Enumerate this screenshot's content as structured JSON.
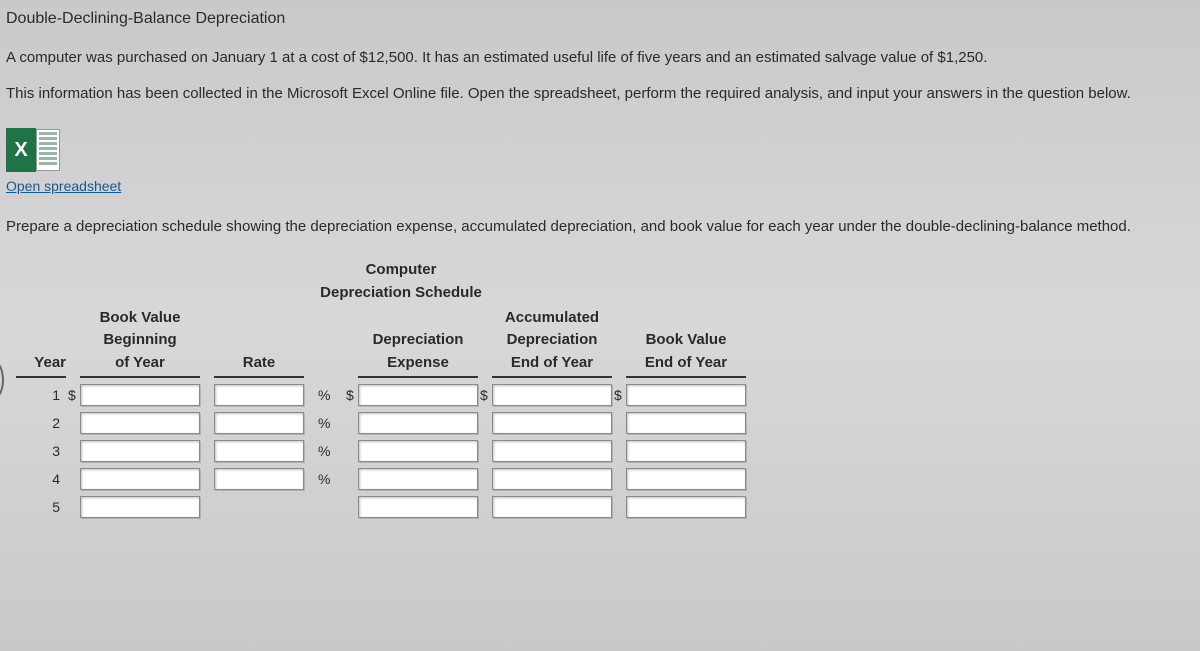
{
  "title": "Double-Declining-Balance Depreciation",
  "paragraph1": "A computer was purchased on January 1 at a cost of $12,500. It has an estimated useful life of five years and an estimated salvage value of $1,250.",
  "paragraph2": "This information has been collected in the Microsoft Excel Online file. Open the spreadsheet, perform the required analysis, and input your answers in the question below.",
  "excelIconLetter": "X",
  "openLinkText": "Open spreadsheet",
  "instruction": "Prepare a depreciation schedule showing the depreciation expense, accumulated depreciation, and book value for each year under the double-declining-balance method.",
  "scheduleTitleLine1": "Computer",
  "scheduleTitleLine2": "Depreciation Schedule",
  "headers": {
    "year": "Year",
    "bvBegin": "Book Value\nBeginning\nof Year",
    "rate": "Rate",
    "depExp": "Depreciation\nExpense",
    "accDep": "Accumulated\nDepreciation\nEnd of Year",
    "bvEnd": "Book Value\nEnd of Year"
  },
  "pctSymbol": "%",
  "dollarSymbol": "$",
  "years": [
    "1",
    "2",
    "3",
    "4",
    "5"
  ],
  "showRatePct": [
    true,
    true,
    true,
    true,
    false
  ],
  "showDollarRow1": true
}
